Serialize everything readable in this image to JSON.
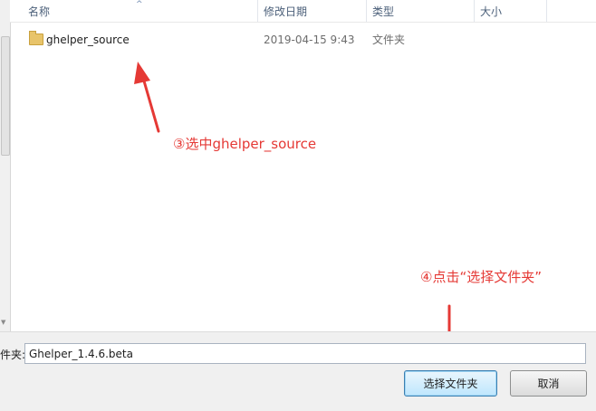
{
  "file_list": {
    "columns": {
      "name": "名称",
      "date_modified": "修改日期",
      "type": "类型",
      "size": "大小"
    },
    "sort_indicator_icon": "sort-ascending-icon",
    "rows": [
      {
        "icon": "folder-icon",
        "name": "ghelper_source",
        "date_modified": "2019-04-15 9:43",
        "type": "文件夹",
        "size": ""
      }
    ]
  },
  "annotations": {
    "step3": "③选中ghelper_source",
    "step4": "④点击“选择文件夹”",
    "color": "#e53935"
  },
  "footer": {
    "folder_label": "件夹:",
    "folder_value": "Ghelper_1.4.6.beta",
    "select_button": "选择文件夹",
    "cancel_button": "取消"
  }
}
